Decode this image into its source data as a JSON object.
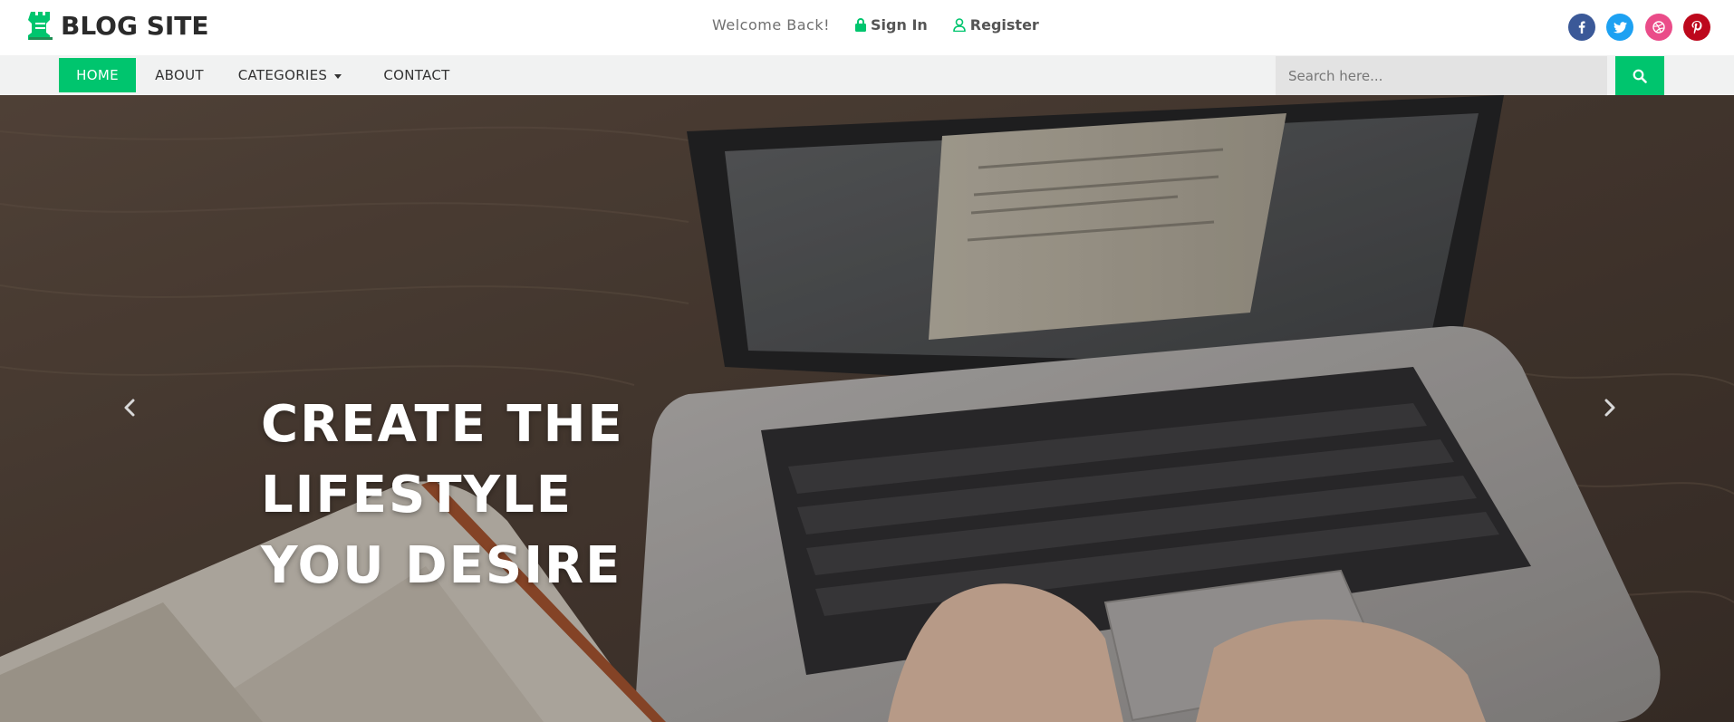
{
  "brand": {
    "name": "BLOG SITE",
    "accent_color": "#00c56e",
    "logo_icon": "chess-rook-icon"
  },
  "header": {
    "welcome": "Welcome Back!",
    "sign_in": {
      "label": "Sign In",
      "icon": "lock-icon"
    },
    "register": {
      "label": "Register",
      "icon": "user-icon"
    },
    "social": [
      {
        "name": "facebook",
        "icon": "facebook-icon",
        "color": "#3b5998"
      },
      {
        "name": "twitter",
        "icon": "twitter-icon",
        "color": "#1da1f2"
      },
      {
        "name": "dribbble",
        "icon": "dribbble-icon",
        "color": "#ea4c89"
      },
      {
        "name": "pinterest",
        "icon": "pinterest-icon",
        "color": "#bd081c"
      }
    ]
  },
  "nav": {
    "items": [
      {
        "label": "HOME",
        "active": true
      },
      {
        "label": "ABOUT",
        "active": false
      },
      {
        "label": "CATEGORIES",
        "active": false,
        "dropdown": true
      },
      {
        "label": "CONTACT",
        "active": false
      }
    ],
    "search": {
      "placeholder": "Search here...",
      "value": "",
      "icon": "search-icon"
    }
  },
  "hero": {
    "title_line1": "CREATE THE LIFESTYLE",
    "title_line2": "YOU DESIRE",
    "prev_icon": "chevron-left-icon",
    "next_icon": "chevron-right-icon"
  }
}
